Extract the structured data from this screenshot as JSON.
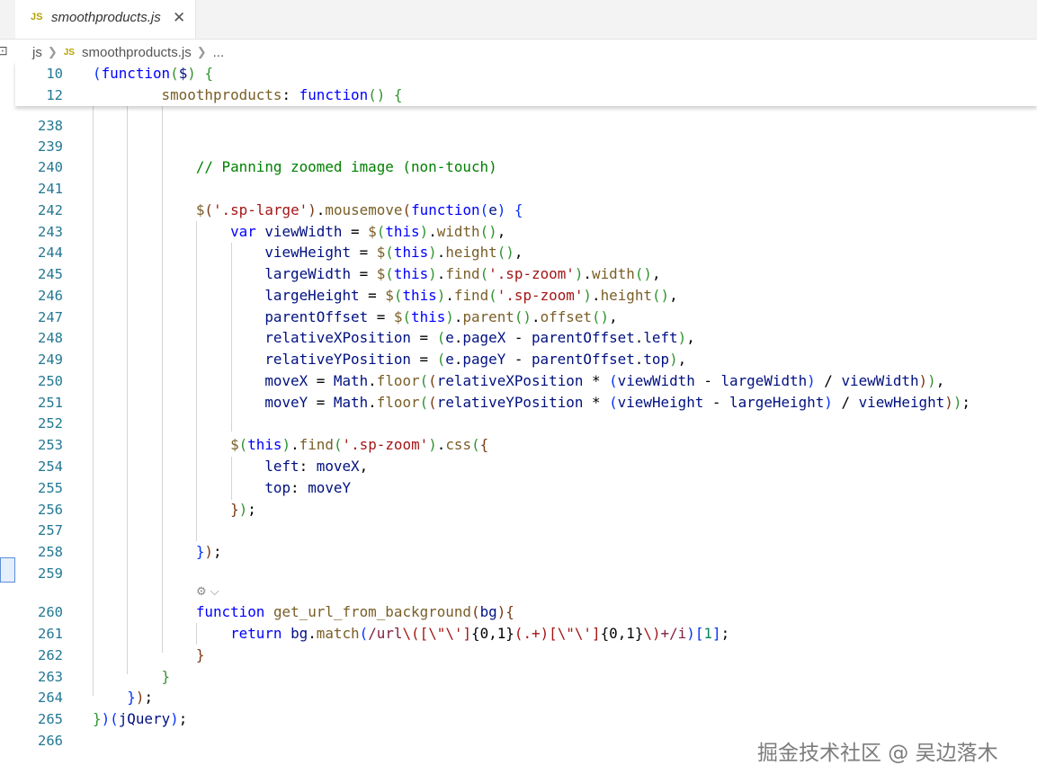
{
  "tab": {
    "badge": "JS",
    "filename": "smoothproducts.js",
    "close": "✕"
  },
  "breadcrumb": {
    "folder": "js",
    "file_badge": "JS",
    "file": "smoothproducts.js",
    "more": "..."
  },
  "sticky": [
    {
      "n": "10",
      "tokens": [
        [
          "(",
          "b1"
        ],
        [
          "function",
          "k"
        ],
        [
          "(",
          "b2"
        ],
        [
          "$",
          "v"
        ],
        [
          ")",
          "b2"
        ],
        [
          " ",
          "p"
        ],
        [
          "{",
          "b2"
        ]
      ]
    },
    {
      "n": "12",
      "tokens": [
        [
          "        ",
          "p"
        ],
        [
          "smoothproducts",
          "f"
        ],
        [
          ": ",
          "p"
        ],
        [
          "function",
          "k"
        ],
        [
          "()",
          "b2"
        ],
        [
          " ",
          "p"
        ],
        [
          "{",
          "b2"
        ]
      ]
    }
  ],
  "lines": [
    {
      "n": "238",
      "tokens": []
    },
    {
      "n": "239",
      "tokens": []
    },
    {
      "n": "240",
      "tokens": [
        [
          "            ",
          "p"
        ],
        [
          "// Panning zoomed image (non-touch)",
          "c"
        ]
      ]
    },
    {
      "n": "241",
      "tokens": []
    },
    {
      "n": "242",
      "tokens": [
        [
          "            ",
          "p"
        ],
        [
          "$",
          "f"
        ],
        [
          "(",
          "b3"
        ],
        [
          "'.sp-large'",
          "s"
        ],
        [
          ")",
          "b3"
        ],
        [
          ".",
          "p"
        ],
        [
          "mousemove",
          "f"
        ],
        [
          "(",
          "b3"
        ],
        [
          "function",
          "k"
        ],
        [
          "(",
          "b1"
        ],
        [
          "e",
          "v"
        ],
        [
          ")",
          "b1"
        ],
        [
          " ",
          "p"
        ],
        [
          "{",
          "b1"
        ]
      ]
    },
    {
      "n": "243",
      "tokens": [
        [
          "                ",
          "p"
        ],
        [
          "var",
          "k"
        ],
        [
          " ",
          "p"
        ],
        [
          "viewWidth",
          "v"
        ],
        [
          " = ",
          "p"
        ],
        [
          "$",
          "f"
        ],
        [
          "(",
          "b2"
        ],
        [
          "this",
          "k"
        ],
        [
          ")",
          "b2"
        ],
        [
          ".",
          "p"
        ],
        [
          "width",
          "f"
        ],
        [
          "()",
          "b2"
        ],
        [
          ",",
          "p"
        ]
      ]
    },
    {
      "n": "244",
      "tokens": [
        [
          "                    ",
          "p"
        ],
        [
          "viewHeight",
          "v"
        ],
        [
          " = ",
          "p"
        ],
        [
          "$",
          "f"
        ],
        [
          "(",
          "b2"
        ],
        [
          "this",
          "k"
        ],
        [
          ")",
          "b2"
        ],
        [
          ".",
          "p"
        ],
        [
          "height",
          "f"
        ],
        [
          "()",
          "b2"
        ],
        [
          ",",
          "p"
        ]
      ]
    },
    {
      "n": "245",
      "tokens": [
        [
          "                    ",
          "p"
        ],
        [
          "largeWidth",
          "v"
        ],
        [
          " = ",
          "p"
        ],
        [
          "$",
          "f"
        ],
        [
          "(",
          "b2"
        ],
        [
          "this",
          "k"
        ],
        [
          ")",
          "b2"
        ],
        [
          ".",
          "p"
        ],
        [
          "find",
          "f"
        ],
        [
          "(",
          "b2"
        ],
        [
          "'.sp-zoom'",
          "s"
        ],
        [
          ")",
          "b2"
        ],
        [
          ".",
          "p"
        ],
        [
          "width",
          "f"
        ],
        [
          "()",
          "b2"
        ],
        [
          ",",
          "p"
        ]
      ]
    },
    {
      "n": "246",
      "tokens": [
        [
          "                    ",
          "p"
        ],
        [
          "largeHeight",
          "v"
        ],
        [
          " = ",
          "p"
        ],
        [
          "$",
          "f"
        ],
        [
          "(",
          "b2"
        ],
        [
          "this",
          "k"
        ],
        [
          ")",
          "b2"
        ],
        [
          ".",
          "p"
        ],
        [
          "find",
          "f"
        ],
        [
          "(",
          "b2"
        ],
        [
          "'.sp-zoom'",
          "s"
        ],
        [
          ")",
          "b2"
        ],
        [
          ".",
          "p"
        ],
        [
          "height",
          "f"
        ],
        [
          "()",
          "b2"
        ],
        [
          ",",
          "p"
        ]
      ]
    },
    {
      "n": "247",
      "tokens": [
        [
          "                    ",
          "p"
        ],
        [
          "parentOffset",
          "v"
        ],
        [
          " = ",
          "p"
        ],
        [
          "$",
          "f"
        ],
        [
          "(",
          "b2"
        ],
        [
          "this",
          "k"
        ],
        [
          ")",
          "b2"
        ],
        [
          ".",
          "p"
        ],
        [
          "parent",
          "f"
        ],
        [
          "()",
          "b2"
        ],
        [
          ".",
          "p"
        ],
        [
          "offset",
          "f"
        ],
        [
          "()",
          "b2"
        ],
        [
          ",",
          "p"
        ]
      ]
    },
    {
      "n": "248",
      "tokens": [
        [
          "                    ",
          "p"
        ],
        [
          "relativeXPosition",
          "v"
        ],
        [
          " = ",
          "p"
        ],
        [
          "(",
          "b2"
        ],
        [
          "e",
          "v"
        ],
        [
          ".",
          "p"
        ],
        [
          "pageX",
          "v"
        ],
        [
          " - ",
          "p"
        ],
        [
          "parentOffset",
          "v"
        ],
        [
          ".",
          "p"
        ],
        [
          "left",
          "v"
        ],
        [
          ")",
          "b2"
        ],
        [
          ",",
          "p"
        ]
      ]
    },
    {
      "n": "249",
      "tokens": [
        [
          "                    ",
          "p"
        ],
        [
          "relativeYPosition",
          "v"
        ],
        [
          " = ",
          "p"
        ],
        [
          "(",
          "b2"
        ],
        [
          "e",
          "v"
        ],
        [
          ".",
          "p"
        ],
        [
          "pageY",
          "v"
        ],
        [
          " - ",
          "p"
        ],
        [
          "parentOffset",
          "v"
        ],
        [
          ".",
          "p"
        ],
        [
          "top",
          "v"
        ],
        [
          ")",
          "b2"
        ],
        [
          ",",
          "p"
        ]
      ]
    },
    {
      "n": "250",
      "tokens": [
        [
          "                    ",
          "p"
        ],
        [
          "moveX",
          "v"
        ],
        [
          " = ",
          "p"
        ],
        [
          "Math",
          "v"
        ],
        [
          ".",
          "p"
        ],
        [
          "floor",
          "f"
        ],
        [
          "(",
          "b2"
        ],
        [
          "(",
          "b3"
        ],
        [
          "relativeXPosition",
          "v"
        ],
        [
          " * ",
          "p"
        ],
        [
          "(",
          "b1"
        ],
        [
          "viewWidth",
          "v"
        ],
        [
          " - ",
          "p"
        ],
        [
          "largeWidth",
          "v"
        ],
        [
          ")",
          "b1"
        ],
        [
          " / ",
          "p"
        ],
        [
          "viewWidth",
          "v"
        ],
        [
          ")",
          "b3"
        ],
        [
          ")",
          "b2"
        ],
        [
          ",",
          "p"
        ]
      ]
    },
    {
      "n": "251",
      "tokens": [
        [
          "                    ",
          "p"
        ],
        [
          "moveY",
          "v"
        ],
        [
          " = ",
          "p"
        ],
        [
          "Math",
          "v"
        ],
        [
          ".",
          "p"
        ],
        [
          "floor",
          "f"
        ],
        [
          "(",
          "b2"
        ],
        [
          "(",
          "b3"
        ],
        [
          "relativeYPosition",
          "v"
        ],
        [
          " * ",
          "p"
        ],
        [
          "(",
          "b1"
        ],
        [
          "viewHeight",
          "v"
        ],
        [
          " - ",
          "p"
        ],
        [
          "largeHeight",
          "v"
        ],
        [
          ")",
          "b1"
        ],
        [
          " / ",
          "p"
        ],
        [
          "viewHeight",
          "v"
        ],
        [
          ")",
          "b3"
        ],
        [
          ")",
          "b2"
        ],
        [
          ";",
          "p"
        ]
      ]
    },
    {
      "n": "252",
      "tokens": []
    },
    {
      "n": "253",
      "tokens": [
        [
          "                ",
          "p"
        ],
        [
          "$",
          "f"
        ],
        [
          "(",
          "b2"
        ],
        [
          "this",
          "k"
        ],
        [
          ")",
          "b2"
        ],
        [
          ".",
          "p"
        ],
        [
          "find",
          "f"
        ],
        [
          "(",
          "b2"
        ],
        [
          "'.sp-zoom'",
          "s"
        ],
        [
          ")",
          "b2"
        ],
        [
          ".",
          "p"
        ],
        [
          "css",
          "f"
        ],
        [
          "(",
          "b2"
        ],
        [
          "{",
          "b3"
        ]
      ]
    },
    {
      "n": "254",
      "tokens": [
        [
          "                    ",
          "p"
        ],
        [
          "left",
          "v"
        ],
        [
          ": ",
          "p"
        ],
        [
          "moveX",
          "v"
        ],
        [
          ",",
          "p"
        ]
      ]
    },
    {
      "n": "255",
      "tokens": [
        [
          "                    ",
          "p"
        ],
        [
          "top",
          "v"
        ],
        [
          ": ",
          "p"
        ],
        [
          "moveY",
          "v"
        ]
      ]
    },
    {
      "n": "256",
      "tokens": [
        [
          "                ",
          "p"
        ],
        [
          "}",
          "b3"
        ],
        [
          ")",
          "b2"
        ],
        [
          ";",
          "p"
        ]
      ]
    },
    {
      "n": "257",
      "tokens": []
    },
    {
      "n": "258",
      "tokens": [
        [
          "            ",
          "p"
        ],
        [
          "}",
          "b1"
        ],
        [
          ")",
          "b3"
        ],
        [
          ";",
          "p"
        ]
      ]
    },
    {
      "n": "259",
      "tokens": []
    },
    {
      "n": "260",
      "tokens": [
        [
          "            ",
          "p"
        ],
        [
          "function",
          "k"
        ],
        [
          " ",
          "p"
        ],
        [
          "get_url_from_background",
          "f"
        ],
        [
          "(",
          "b3"
        ],
        [
          "bg",
          "v"
        ],
        [
          ")",
          "b3"
        ],
        [
          "{",
          "b3"
        ]
      ]
    },
    {
      "n": "261",
      "tokens": [
        [
          "                ",
          "p"
        ],
        [
          "return",
          "k"
        ],
        [
          " ",
          "p"
        ],
        [
          "bg",
          "v"
        ],
        [
          ".",
          "p"
        ],
        [
          "match",
          "f"
        ],
        [
          "(",
          "b1"
        ],
        [
          "/url",
          "rx"
        ],
        [
          "\\(",
          "s"
        ],
        [
          "[\\\"\\']",
          "s"
        ],
        [
          "{0,1}",
          "p"
        ],
        [
          "(.+)",
          "s"
        ],
        [
          "[\\\"\\']",
          "s"
        ],
        [
          "{0,1}",
          "p"
        ],
        [
          "\\)",
          "s"
        ],
        [
          "+/i",
          "rx"
        ],
        [
          ")",
          "b1"
        ],
        [
          "[",
          "b1"
        ],
        [
          "1",
          "n"
        ],
        [
          "]",
          "b1"
        ],
        [
          ";",
          "p"
        ]
      ]
    },
    {
      "n": "262",
      "tokens": [
        [
          "            ",
          "p"
        ],
        [
          "}",
          "b3"
        ]
      ]
    },
    {
      "n": "263",
      "tokens": [
        [
          "        ",
          "p"
        ],
        [
          "}",
          "b2"
        ]
      ]
    },
    {
      "n": "264",
      "tokens": [
        [
          "    ",
          "p"
        ],
        [
          "}",
          "b1"
        ],
        [
          ")",
          "b3"
        ],
        [
          ";",
          "p"
        ]
      ]
    },
    {
      "n": "265",
      "tokens": [
        [
          "",
          "p"
        ],
        [
          "}",
          "b2"
        ],
        [
          ")",
          "b1"
        ],
        [
          "(",
          "b1"
        ],
        [
          "jQuery",
          "v"
        ],
        [
          ")",
          "b1"
        ],
        [
          ";",
          "p"
        ]
      ]
    },
    {
      "n": "266",
      "tokens": []
    }
  ],
  "codelens": "⚙ ⌵",
  "watermark": "掘金技术社区 @ 吴边落木"
}
